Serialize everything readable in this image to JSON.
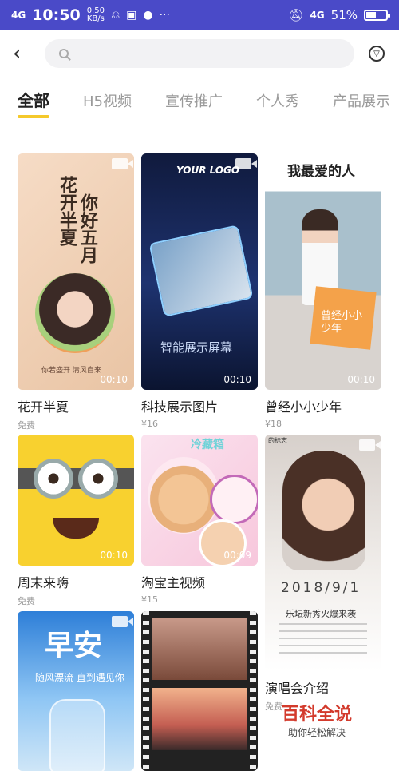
{
  "status": {
    "network": "4G",
    "time": "10:50",
    "speed": "0.50",
    "speed_unit": "KB/s",
    "dots": "···",
    "network_right": "4G",
    "battery": "51%",
    "battery_level_percent": 51
  },
  "search": {
    "placeholder": "",
    "value": ""
  },
  "tabs": [
    {
      "label": "全部",
      "active": true
    },
    {
      "label": "H5视频",
      "active": false
    },
    {
      "label": "宣传推广",
      "active": false
    },
    {
      "label": "个人秀",
      "active": false
    },
    {
      "label": "产品展示",
      "active": false
    }
  ],
  "cards": [
    {
      "title": "花开半夏",
      "price": "免费",
      "duration": "00:10",
      "poster_lines": [
        "花开半夏",
        "你好五月"
      ],
      "poster_caption": "你若盛开 清风自来"
    },
    {
      "title": "科技展示图片",
      "price": "¥16",
      "duration": "00:10",
      "poster_logo": "YOUR LOGO",
      "poster_caption": "智能展示屏幕"
    },
    {
      "title": "曾经小小少年",
      "price": "¥18",
      "duration": "00:10",
      "poster_heading": "我最爱的人",
      "poster_note": "曾经小小少年"
    },
    {
      "title": "周末来嗨",
      "price": "免费",
      "duration": "00:10"
    },
    {
      "title": "淘宝主视频",
      "price": "¥15",
      "duration": "00:09",
      "poster_heading": "冷藏箱"
    },
    {
      "title": "演唱会介绍",
      "price": "免费",
      "duration": "",
      "poster_date": "2018/9/1",
      "poster_lines": [
        "乐坛新秀火爆来袭"
      ],
      "poster_corner": "的标志"
    },
    {
      "title": "",
      "price": "",
      "duration": "",
      "poster_heading": "早安",
      "poster_caption": "随风漂流 直到遇见你"
    },
    {
      "title": "",
      "price": "",
      "duration": ""
    }
  ],
  "watermark": {
    "title": "百科全说",
    "subtitle": "助你轻松解决"
  },
  "colors": {
    "statusbar": "#4a4ac8",
    "tab_underline": "#f5c92b",
    "watermark": "#d33a2c"
  }
}
